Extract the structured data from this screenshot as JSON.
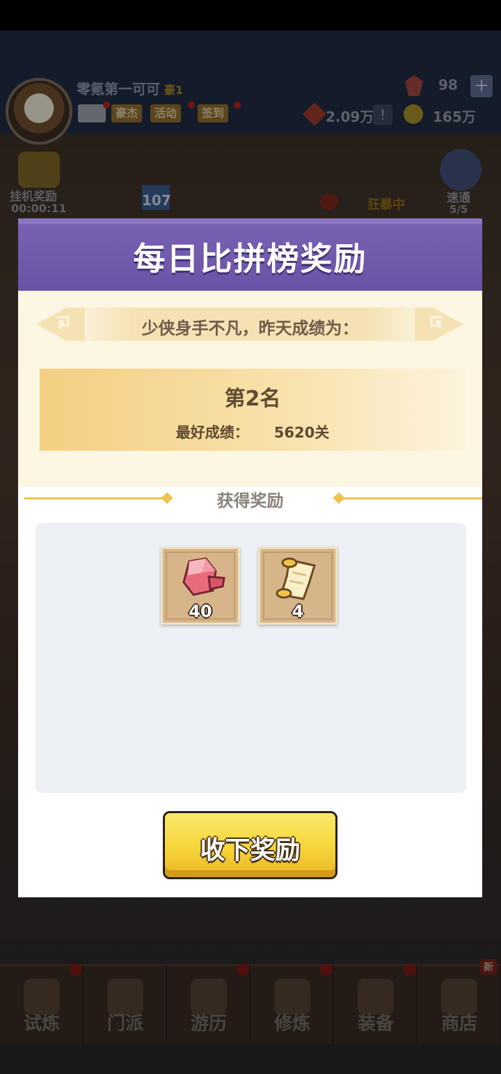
{
  "background": {
    "player": {
      "name": "零氪第一可可",
      "vip": "豪1"
    },
    "top_tags": [
      "豪杰",
      "活动",
      "签到"
    ],
    "resources": {
      "gems": "98",
      "power": "2.09万",
      "coins": "165万"
    },
    "idle_reward": {
      "label": "挂机奖励",
      "timer": "00:00:11"
    },
    "level": "107",
    "rage_label": "狂暴中",
    "sweep": {
      "label": "速通",
      "count": "5/5"
    },
    "bottom_nav": [
      {
        "label": "试炼",
        "icon": "ninja-icon"
      },
      {
        "label": "门派",
        "icon": "temple-icon"
      },
      {
        "label": "游历",
        "icon": "landscape-icon"
      },
      {
        "label": "修炼",
        "icon": "book-icon"
      },
      {
        "label": "装备",
        "icon": "sword-icon"
      },
      {
        "label": "商店",
        "icon": "shop-icon"
      }
    ],
    "new_badge": "新"
  },
  "modal": {
    "title": "每日比拼榜奖励",
    "subtitle": "少侠身手不凡，昨天成绩为：",
    "rank": "第2名",
    "best_label": "最好成绩：",
    "best_value": "5620关",
    "rewards_heading": "获得奖励",
    "rewards": [
      {
        "icon": "ruby-gem-icon",
        "quantity": "40"
      },
      {
        "icon": "scroll-icon",
        "quantity": "4"
      }
    ],
    "claim_button": "收下奖励"
  },
  "colors": {
    "header_purple": "#6a52a6",
    "cream": "#fdf6e3",
    "gold": "#f2c24e",
    "button_yellow": "#f6d53a"
  }
}
